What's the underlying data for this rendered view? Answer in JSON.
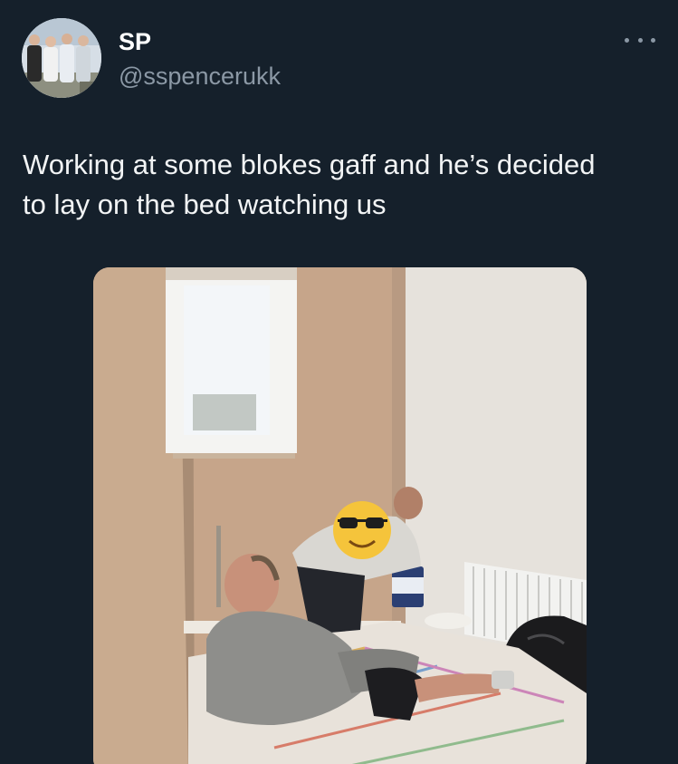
{
  "author": {
    "name": "SP",
    "handle": "@sspencerukk",
    "avatar_icon": "group-photo-avatar"
  },
  "more_icon": "more-options-icon",
  "tweet": {
    "text": "Working at some blokes gaff and he’s decided\nto lay on the bed watching us"
  },
  "media": {
    "icon": "bedroom-photo",
    "overlay_emoji": "😎"
  },
  "colors": {
    "background": "#15202b",
    "text_primary": "#ffffff",
    "text_secondary": "#8b98a5"
  }
}
